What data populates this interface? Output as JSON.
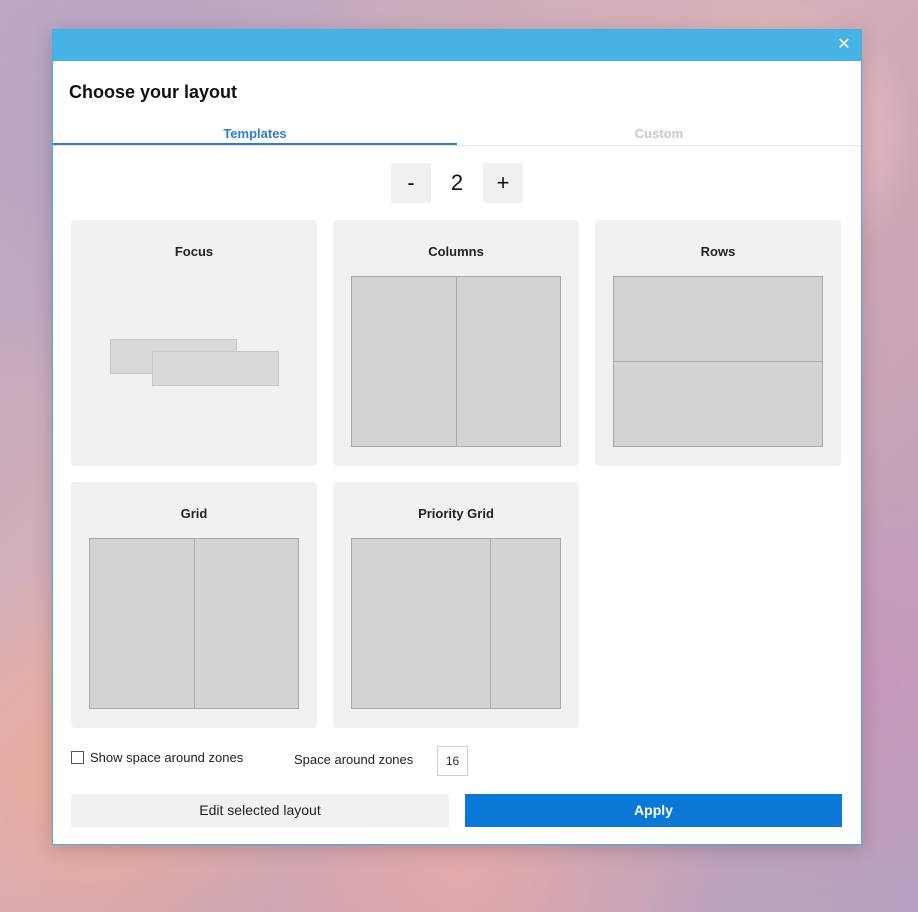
{
  "dialog": {
    "close_glyph": "✕",
    "heading": "Choose your layout",
    "tabs": [
      {
        "label": "Templates",
        "active": true
      },
      {
        "label": "Custom",
        "active": false
      }
    ],
    "stepper": {
      "minus_label": "-",
      "value": "2",
      "plus_label": "+"
    },
    "templates": [
      {
        "title": "Focus"
      },
      {
        "title": "Columns"
      },
      {
        "title": "Rows"
      },
      {
        "title": "Grid"
      },
      {
        "title": "Priority Grid"
      }
    ],
    "options": {
      "show_space_label": "Show space around zones",
      "show_space_checked": false,
      "space_label": "Space around zones",
      "space_value": "16"
    },
    "buttons": {
      "edit_label": "Edit selected layout",
      "apply_label": "Apply"
    }
  },
  "colors": {
    "titlebar": "#47b2e4",
    "accent": "#2f7ccb",
    "apply": "#0b78d7"
  }
}
